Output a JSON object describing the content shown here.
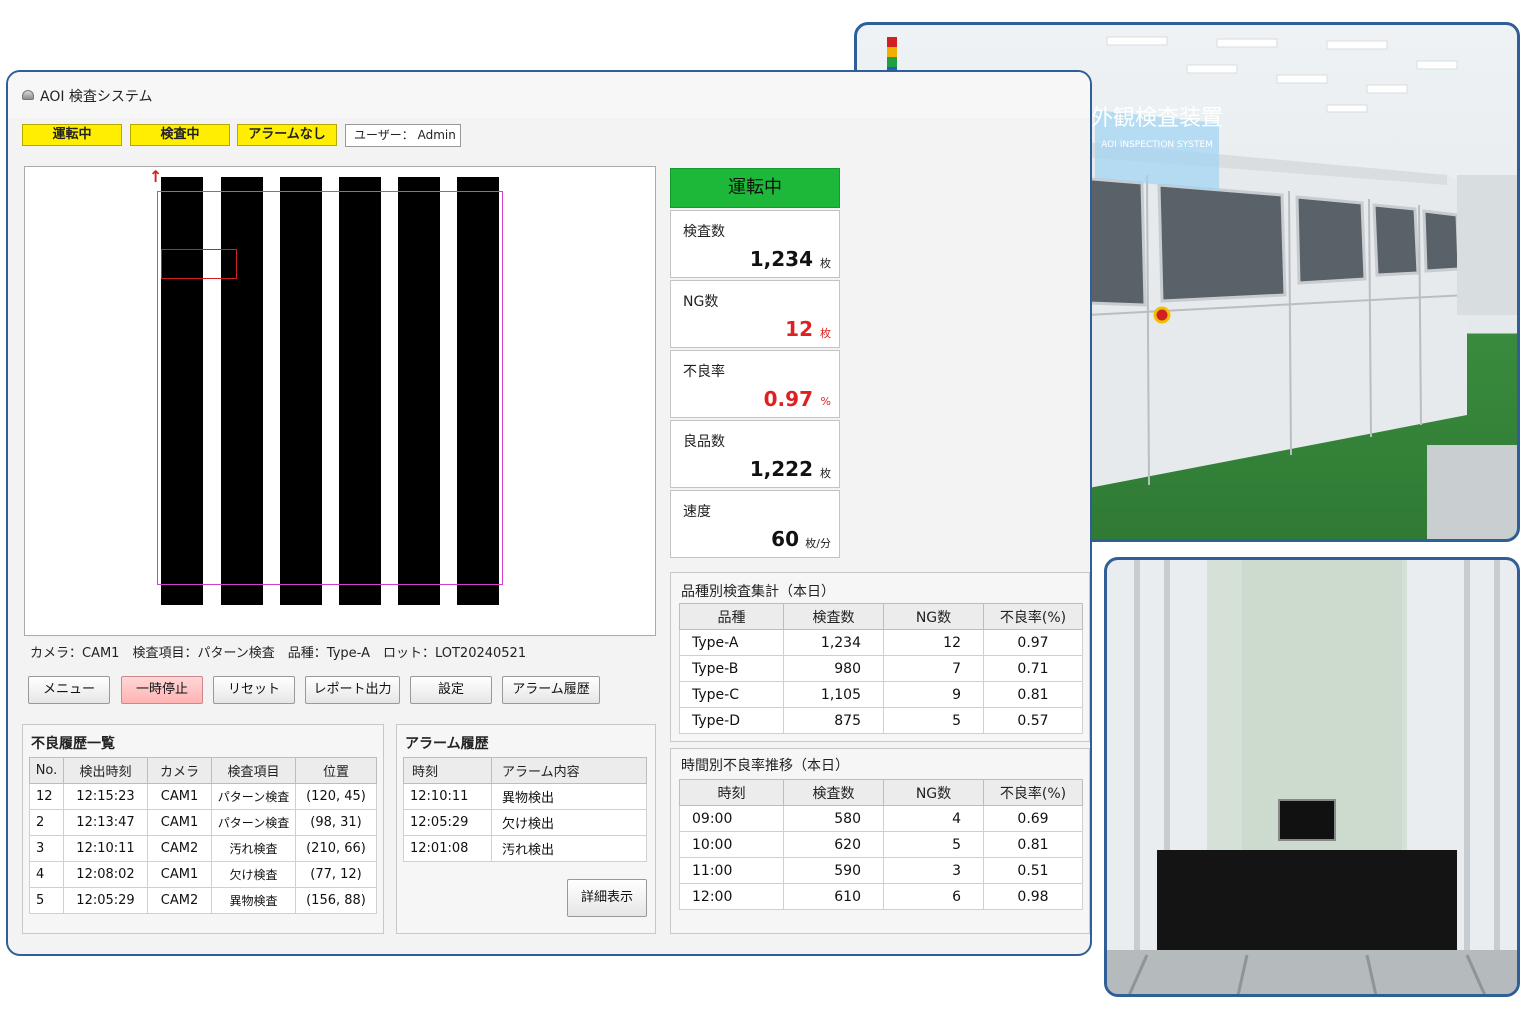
{
  "window": {
    "title": "AOI 検査システム"
  },
  "status_bar": {
    "running": "運転中",
    "inspecting": "検査中",
    "alarm": "アラームなし",
    "user": "ユーザー： Admin"
  },
  "colors": {
    "accent": "#2f5f96",
    "status_yellow": "#ffee00",
    "running_green": "#1db83a",
    "ng_red": "#e02020",
    "pause_pink": "#ffb3b3"
  },
  "viewer": {
    "info": "カメラ：CAM1　検査項目：パターン検査　品種：Type-A　ロット：LOT20240521"
  },
  "toolbar": {
    "menu": "メニュー",
    "pause": "一時停止",
    "reset": "リセット",
    "report": "レポート出力",
    "settings": "設定",
    "alarm_history": "アラーム履歴"
  },
  "stats": {
    "state": "運転中",
    "inspected": {
      "label": "検査数",
      "value": "1,234",
      "unit": "枚"
    },
    "ng": {
      "label": "NG数",
      "value": "12",
      "unit": "枚"
    },
    "defect_rate": {
      "label": "不良率",
      "value": "0.97",
      "unit": "%"
    },
    "good": {
      "label": "良品数",
      "value": "1,222",
      "unit": "枚"
    },
    "speed": {
      "label": "速度",
      "value": "60",
      "unit": "枚/分"
    }
  },
  "defect_history": {
    "title": "不良履歴一覧",
    "headers": [
      "No.",
      "検出時刻",
      "カメラ",
      "検査項目",
      "位置"
    ],
    "rows": [
      [
        "12",
        "12:15:23",
        "CAM1",
        "パターン検査",
        "(120, 45)"
      ],
      [
        "2",
        "12:13:47",
        "CAM1",
        "パターン検査",
        "(98, 31)"
      ],
      [
        "3",
        "12:10:11",
        "CAM2",
        "汚れ検査",
        "(210, 66)"
      ],
      [
        "4",
        "12:08:02",
        "CAM1",
        "欠け検査",
        "(77, 12)"
      ],
      [
        "5",
        "12:05:29",
        "CAM2",
        "異物検査",
        "(156, 88)"
      ]
    ]
  },
  "alarm_history": {
    "title": "アラーム履歴",
    "headers": [
      "時刻",
      "アラーム内容"
    ],
    "rows": [
      [
        "12:10:11",
        "異物検出"
      ],
      [
        "12:05:29",
        "欠け検出"
      ],
      [
        "12:01:08",
        "汚れ検出"
      ]
    ],
    "detail_button": "詳細表示"
  },
  "product_summary": {
    "title": "品種別検査集計（本日）",
    "headers": [
      "品種",
      "検査数",
      "NG数",
      "不良率(%)"
    ],
    "rows": [
      [
        "Type-A",
        "1,234",
        "12",
        "0.97"
      ],
      [
        "Type-B",
        "980",
        "7",
        "0.71"
      ],
      [
        "Type-C",
        "1,105",
        "9",
        "0.81"
      ],
      [
        "Type-D",
        "875",
        "5",
        "0.57"
      ]
    ]
  },
  "hourly_trend": {
    "title": "時間別不良率推移（本日）",
    "headers": [
      "時刻",
      "検査数",
      "NG数",
      "不良率(%)"
    ],
    "rows": [
      [
        "09:00",
        "580",
        "4",
        "0.69"
      ],
      [
        "10:00",
        "620",
        "5",
        "0.81"
      ],
      [
        "11:00",
        "590",
        "3",
        "0.51"
      ],
      [
        "12:00",
        "610",
        "6",
        "0.98"
      ]
    ]
  },
  "machine_photo": {
    "sign_main": "外観検査装置",
    "sign_sub": "AOI INSPECTION SYSTEM"
  }
}
